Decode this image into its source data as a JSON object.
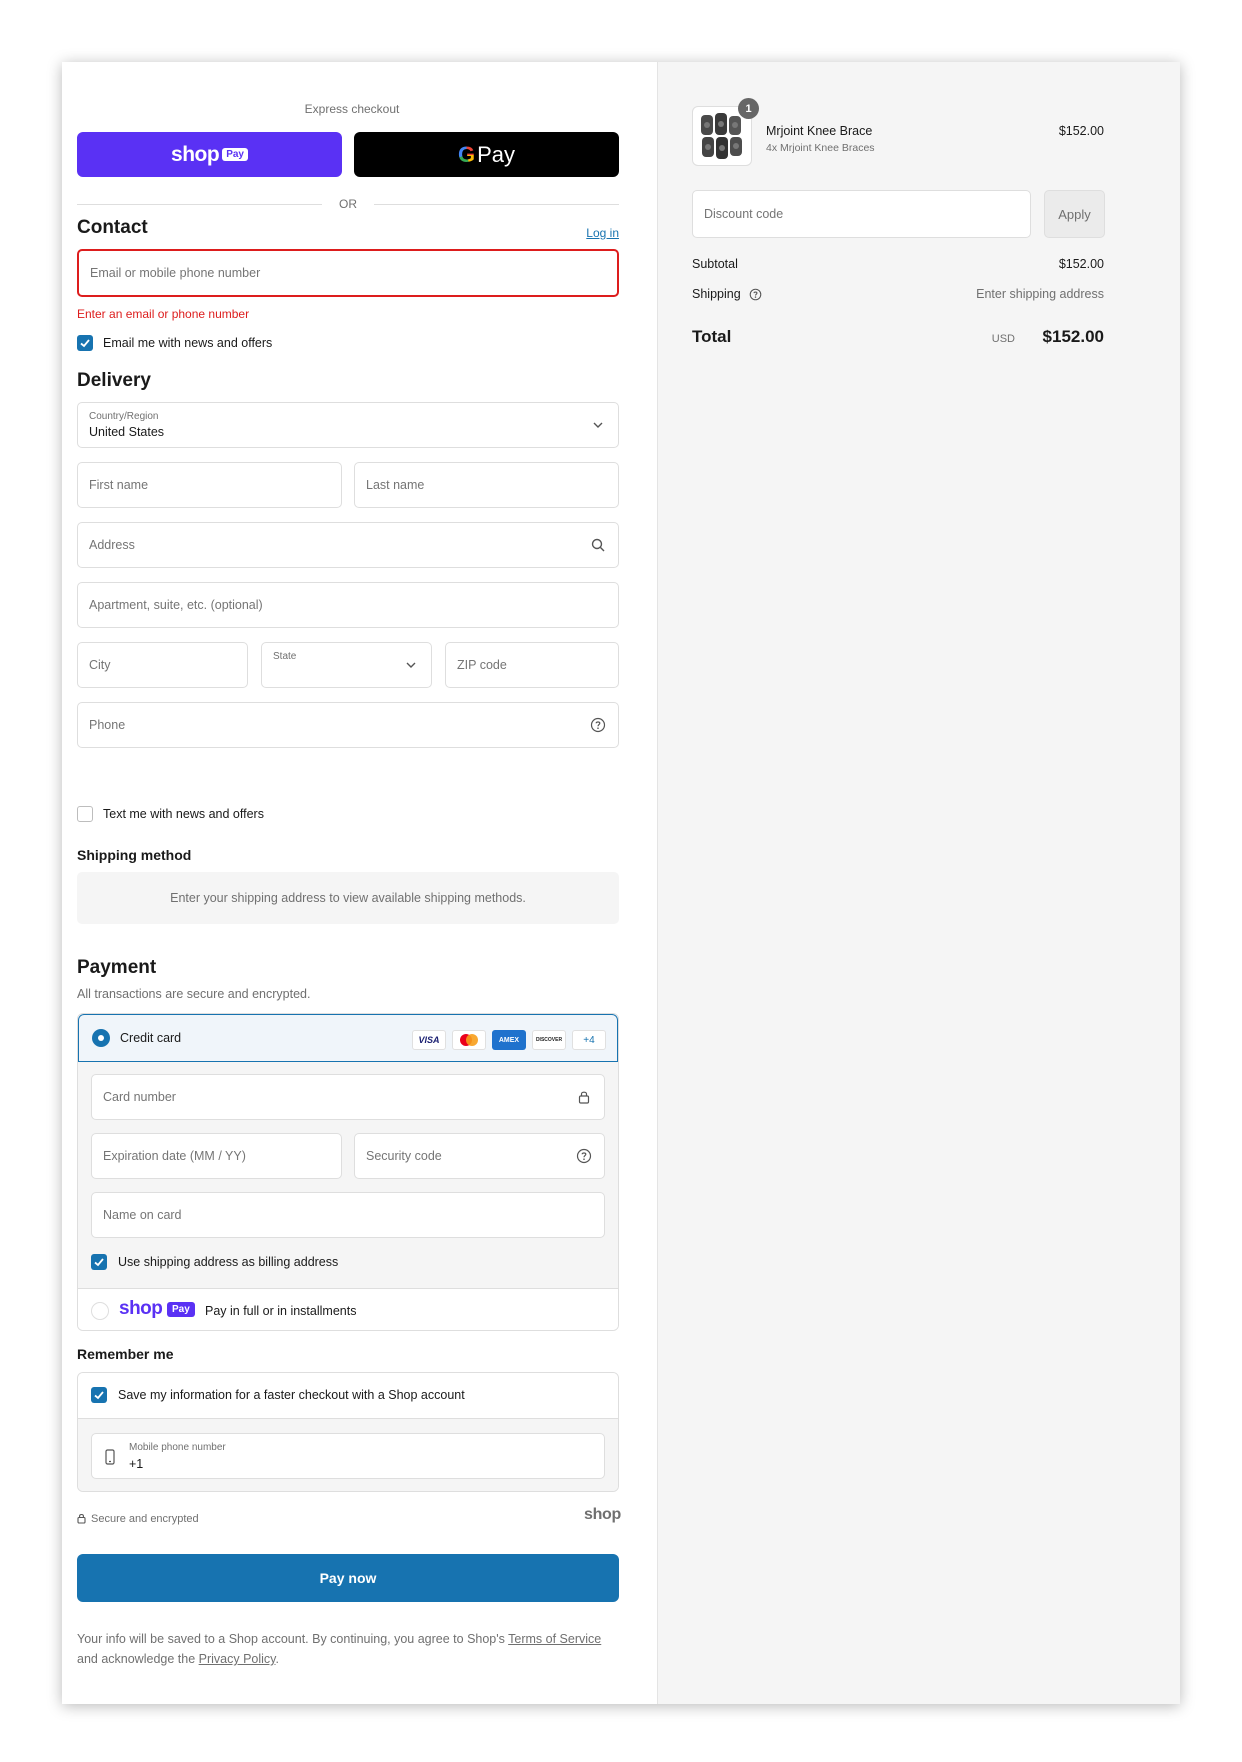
{
  "express": {
    "title": "Express checkout",
    "shop_pay_word": "shop",
    "shop_pay_pill": "Pay",
    "gpay_g": "G",
    "gpay_word": "Pay",
    "or": "OR"
  },
  "contact": {
    "heading": "Contact",
    "login_link": "Log in",
    "email_placeholder": "Email or mobile phone number",
    "error": "Enter an email or phone number",
    "marketing_label": "Email me with news and offers",
    "marketing_checked": true
  },
  "delivery": {
    "heading": "Delivery",
    "country_label": "Country/Region",
    "country_value": "United States",
    "first_name_placeholder": "First name",
    "last_name_placeholder": "Last name",
    "address_placeholder": "Address",
    "apartment_placeholder": "Apartment, suite, etc. (optional)",
    "city_placeholder": "City",
    "state_label": "State",
    "zip_placeholder": "ZIP code",
    "phone_placeholder": "Phone",
    "sms_label": "Text me with news and offers",
    "sms_checked": false
  },
  "shipping_method": {
    "heading": "Shipping method",
    "notice": "Enter your shipping address to view available shipping methods."
  },
  "payment": {
    "heading": "Payment",
    "subheading": "All transactions are secure and encrypted.",
    "credit_card_label": "Credit card",
    "brands": [
      "VISA",
      "AMEX",
      "DISCOVER",
      "+4"
    ],
    "card_number_placeholder": "Card number",
    "expiration_placeholder": "Expiration date (MM / YY)",
    "security_placeholder": "Security code",
    "name_placeholder": "Name on card",
    "billing_label": "Use shipping address as billing address",
    "billing_checked": true,
    "shop_pay_word": "shop",
    "shop_pay_pill": "Pay",
    "shop_pay_label": "Pay in full or in installments"
  },
  "remember": {
    "heading": "Remember me",
    "save_label": "Save my information for a faster checkout with a Shop account",
    "save_checked": true,
    "mobile_label": "Mobile phone number",
    "mobile_value": "+1",
    "secure_label": "Secure and encrypted",
    "shop_logo": "shop"
  },
  "pay_now_label": "Pay now",
  "legal": {
    "text_1": "Your info will be saved to a Shop account. By continuing, you agree to Shop's ",
    "terms_link": "Terms of Service",
    "text_2": " and acknowledge the ",
    "privacy_link": "Privacy Policy",
    "text_3": "."
  },
  "summary": {
    "product_name": "Mrjoint Knee Brace",
    "product_variant": "4x Mrjoint Knee Braces",
    "product_price": "$152.00",
    "quantity_badge": "1",
    "discount_placeholder": "Discount code",
    "apply_label": "Apply",
    "subtotal_label": "Subtotal",
    "subtotal_value": "$152.00",
    "shipping_label": "Shipping",
    "shipping_value": "Enter shipping address",
    "total_label": "Total",
    "total_currency": "USD",
    "total_value": "$152.00"
  },
  "colors": {
    "accent": "#1773b0",
    "shop_pay": "#5a31f4",
    "error": "#dd1d1d"
  }
}
